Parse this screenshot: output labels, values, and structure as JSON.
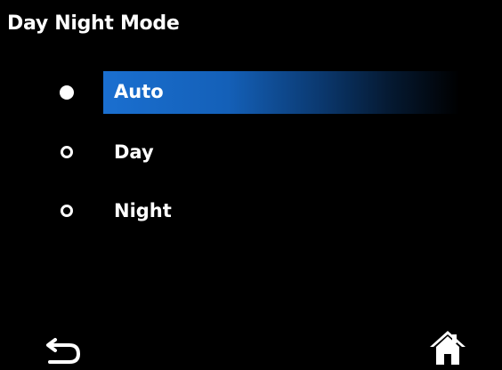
{
  "header": {
    "title": "Day Night Mode"
  },
  "options": [
    {
      "label": "Auto",
      "selected": true
    },
    {
      "label": "Day",
      "selected": false
    },
    {
      "label": "Night",
      "selected": false
    }
  ],
  "footer": {
    "back_icon": "back-arrow-icon",
    "home_icon": "home-icon"
  },
  "colors": {
    "background": "#000000",
    "text": "#ffffff",
    "highlight": "#1a6fd0"
  }
}
